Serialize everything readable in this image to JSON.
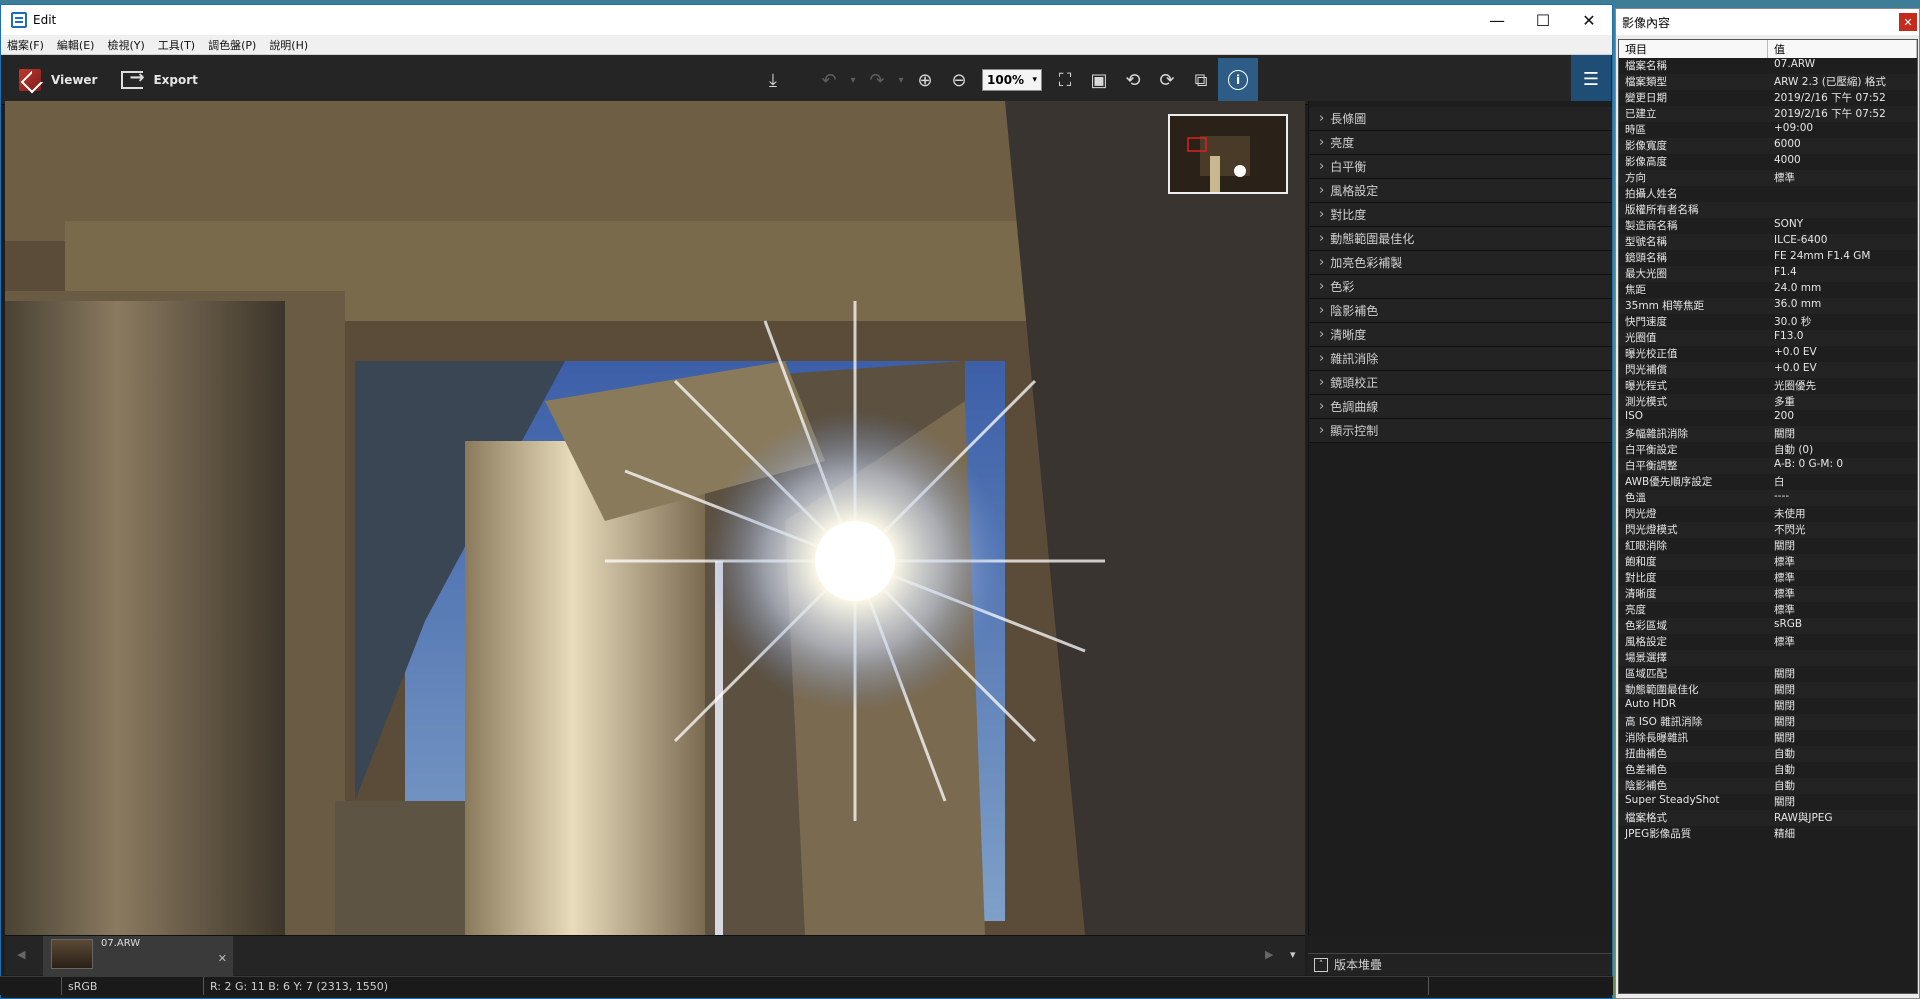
{
  "window": {
    "title": "Edit"
  },
  "menu": [
    "檔案(F)",
    "編輯(E)",
    "檢視(Y)",
    "工具(T)",
    "調色盤(P)",
    "說明(H)"
  ],
  "toolbar": {
    "viewer_label": "Viewer",
    "export_label": "Export",
    "zoom": "100%"
  },
  "adjust_panel": {
    "items": [
      "長條圖",
      "亮度",
      "白平衡",
      "風格設定",
      "對比度",
      "動態範圍最佳化",
      "加亮色彩補製",
      "色彩",
      "陰影補色",
      "清晰度",
      "雜訊消除",
      "鏡頭校正",
      "色調曲線",
      "顯示控制"
    ],
    "footer": "版本堆疊"
  },
  "filmstrip": {
    "file": "07.ARW"
  },
  "status": {
    "colorspace": "sRGB",
    "pixel": "R:  2  G:  11  B:  6  Y:  7    (2313, 1550)"
  },
  "properties": {
    "title": "影像內容",
    "col_item": "項目",
    "col_value": "值",
    "rows": [
      [
        "檔案名稱",
        "07.ARW"
      ],
      [
        "檔案類型",
        "ARW 2.3 (已壓縮) 格式"
      ],
      [
        "變更日期",
        "2019/2/16 下午 07:52"
      ],
      [
        "已建立",
        "2019/2/16 下午 07:52"
      ],
      [
        "時區",
        "+09:00"
      ],
      [
        "影像寬度",
        "6000"
      ],
      [
        "影像高度",
        "4000"
      ],
      [
        "方向",
        "標準"
      ],
      [
        "拍攝人姓名",
        ""
      ],
      [
        "版權所有者名稱",
        ""
      ],
      [
        "製造商名稱",
        "SONY"
      ],
      [
        "型號名稱",
        "ILCE-6400"
      ],
      [
        "鏡頭名稱",
        "FE 24mm F1.4 GM"
      ],
      [
        "最大光圈",
        "F1.4"
      ],
      [
        "焦距",
        "24.0 mm"
      ],
      [
        "35mm 相等焦距",
        "36.0 mm"
      ],
      [
        "快門速度",
        "30.0 秒"
      ],
      [
        "光圈值",
        "F13.0"
      ],
      [
        "曝光校正值",
        "+0.0 EV"
      ],
      [
        "閃光補償",
        "+0.0 EV"
      ],
      [
        "曝光程式",
        "光圈優先"
      ],
      [
        "測光模式",
        "多重"
      ],
      [
        "ISO",
        "200"
      ],
      [
        "多幅雜訊消除",
        "關閉"
      ],
      [
        "白平衡設定",
        "自動 (0)"
      ],
      [
        "白平衡調整",
        "A-B: 0 G-M: 0"
      ],
      [
        "AWB優先順序設定",
        "白"
      ],
      [
        "色溫",
        "----"
      ],
      [
        "閃光燈",
        "未使用"
      ],
      [
        "閃光燈模式",
        "不閃光"
      ],
      [
        "紅眼消除",
        "關閉"
      ],
      [
        "飽和度",
        "標準"
      ],
      [
        "對比度",
        "標準"
      ],
      [
        "清晰度",
        "標準"
      ],
      [
        "亮度",
        "標準"
      ],
      [
        "色彩區域",
        "sRGB"
      ],
      [
        "風格設定",
        "標準"
      ],
      [
        "場景選擇",
        ""
      ],
      [
        "區域匹配",
        "關閉"
      ],
      [
        "動態範圍最佳化",
        "關閉"
      ],
      [
        "Auto HDR",
        "關閉"
      ],
      [
        "高 ISO 雜訊消除",
        "關閉"
      ],
      [
        "消除長曝雜訊",
        "關閉"
      ],
      [
        "扭曲補色",
        "自動"
      ],
      [
        "色差補色",
        "自動"
      ],
      [
        "陰影補色",
        "自動"
      ],
      [
        "Super SteadyShot",
        "關閉"
      ],
      [
        "檔案格式",
        "RAW與JPEG"
      ],
      [
        "JPEG影像品質",
        "精細"
      ]
    ]
  }
}
